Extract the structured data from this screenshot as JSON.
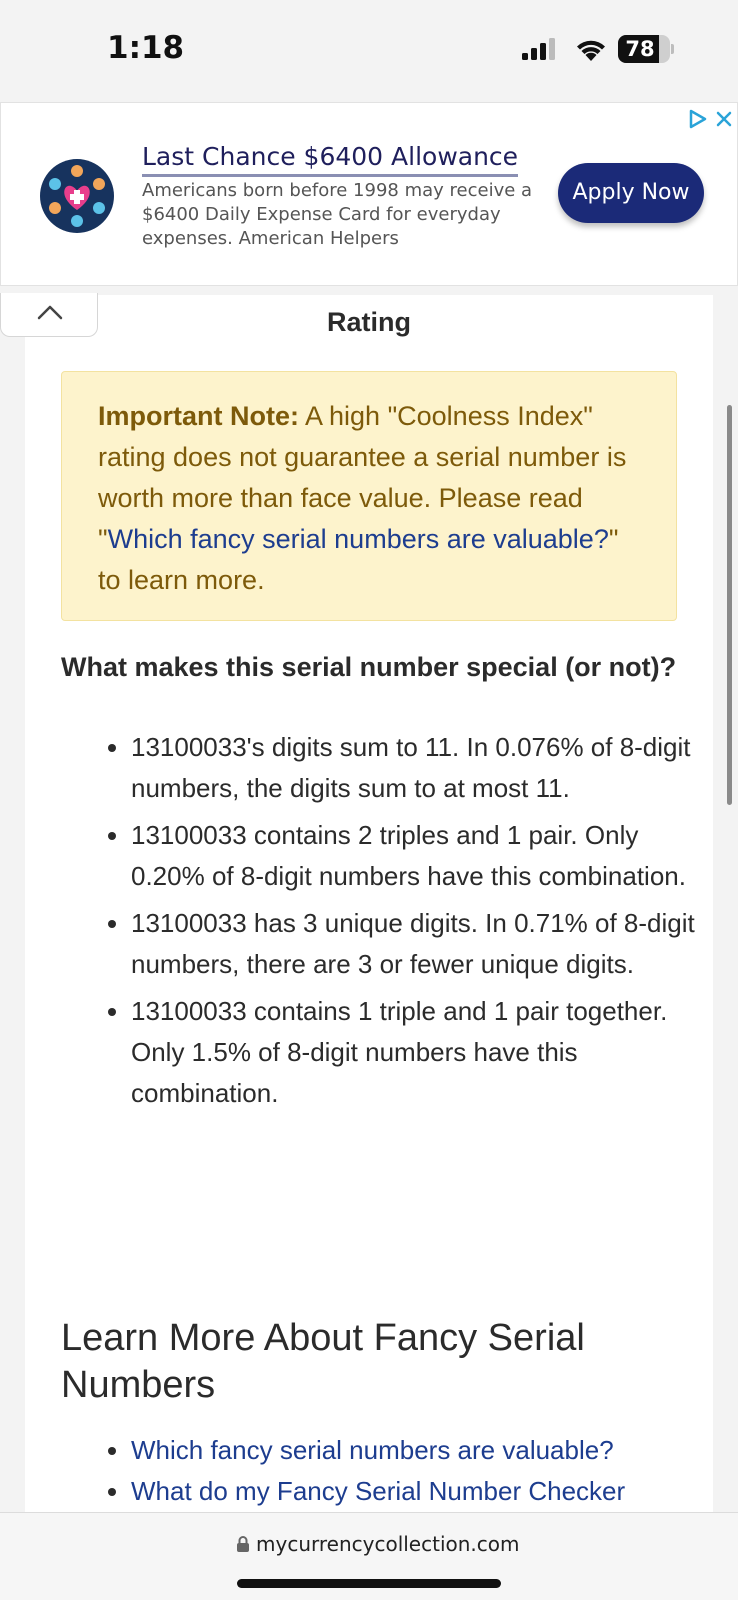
{
  "status_bar": {
    "time": "1:18",
    "battery": "78",
    "battery_level": 0.78
  },
  "ad": {
    "title": "Last Chance $6400 Allowance",
    "description": "Americans born before 1998 may receive a $6400 Daily Expense Card for everyday expenses. American Helpers",
    "button": "Apply Now",
    "icons": [
      "ad-choices-icon",
      "close-icon"
    ]
  },
  "page": {
    "rating_heading": "Rating",
    "note": {
      "label": "Important Note:",
      "text_before": " A high \"Coolness Index\" rating does not guarantee a serial number is worth more than face value. Please read \"",
      "link": "Which fancy serial numbers are valuable?",
      "text_after": "\" to learn more."
    },
    "special_heading": "What makes this serial number special (or not)?",
    "facts": [
      "13100033's digits sum to 11. In 0.076% of 8-digit numbers, the digits sum to at most 11.",
      "13100033 contains 2 triples and 1 pair. Only 0.20% of 8-digit numbers have this combination.",
      "13100033 has 3 unique digits. In 0.71% of 8-digit numbers, there are 3 or fewer unique digits.",
      "13100033 contains 1 triple and 1 pair together. Only 1.5% of 8-digit numbers have this combination."
    ],
    "learn_heading": "Learn More About Fancy Serial Numbers",
    "links": [
      "Which fancy serial numbers are valuable?",
      "What do my Fancy Serial Number Checker"
    ]
  },
  "browser": {
    "url": "mycurrencycollection.com"
  },
  "colors": {
    "note_background": "#fdf3cc",
    "note_text": "#7d5a0a",
    "link": "#1d3d8f",
    "ad_button": "#1b2a78"
  }
}
